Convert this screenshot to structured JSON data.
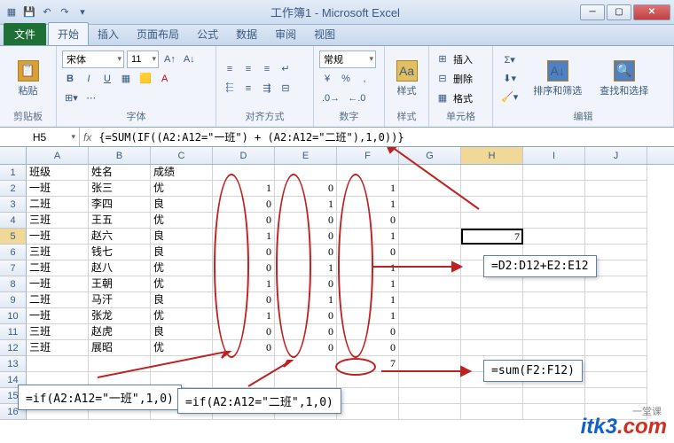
{
  "title": "工作簿1 - Microsoft Excel",
  "tabs": {
    "file": "文件",
    "home": "开始",
    "insert": "插入",
    "layout": "页面布局",
    "formula": "公式",
    "data": "数据",
    "review": "审阅",
    "view": "视图"
  },
  "ribbon": {
    "clipboard": {
      "label": "剪贴板",
      "paste": "粘贴"
    },
    "font": {
      "label": "字体",
      "name": "宋体",
      "size": "11"
    },
    "align": {
      "label": "对齐方式"
    },
    "number": {
      "label": "数字",
      "format": "常规"
    },
    "styles": {
      "label": "样式",
      "btn": "样式"
    },
    "cells": {
      "label": "单元格",
      "insert": "插入",
      "delete": "删除",
      "format": "格式"
    },
    "editing": {
      "label": "编辑",
      "sort": "排序和筛选",
      "find": "查找和选择"
    }
  },
  "namebox": "H5",
  "formula": "{=SUM(IF((A2:A12=\"一班\") + (A2:A12=\"二班\"),1,0))}",
  "cols": [
    "A",
    "B",
    "C",
    "D",
    "E",
    "F",
    "G",
    "H",
    "I",
    "J"
  ],
  "rows": [
    {
      "n": "1",
      "c": [
        "班级",
        "姓名",
        "成绩",
        "",
        "",
        "",
        "",
        "",
        "",
        ""
      ]
    },
    {
      "n": "2",
      "c": [
        "一班",
        "张三",
        "优",
        "1",
        "0",
        "1",
        "",
        "",
        "",
        ""
      ]
    },
    {
      "n": "3",
      "c": [
        "二班",
        "李四",
        "良",
        "0",
        "1",
        "1",
        "",
        "",
        "",
        ""
      ]
    },
    {
      "n": "4",
      "c": [
        "三班",
        "王五",
        "优",
        "0",
        "0",
        "0",
        "",
        "",
        "",
        ""
      ]
    },
    {
      "n": "5",
      "c": [
        "一班",
        "赵六",
        "良",
        "1",
        "0",
        "1",
        "",
        "7",
        "",
        ""
      ]
    },
    {
      "n": "6",
      "c": [
        "三班",
        "钱七",
        "良",
        "0",
        "0",
        "0",
        "",
        "",
        "",
        ""
      ]
    },
    {
      "n": "7",
      "c": [
        "二班",
        "赵八",
        "优",
        "0",
        "1",
        "1",
        "",
        "",
        "",
        ""
      ]
    },
    {
      "n": "8",
      "c": [
        "一班",
        "王朝",
        "优",
        "1",
        "0",
        "1",
        "",
        "",
        "",
        ""
      ]
    },
    {
      "n": "9",
      "c": [
        "二班",
        "马汗",
        "良",
        "0",
        "1",
        "1",
        "",
        "",
        "",
        ""
      ]
    },
    {
      "n": "10",
      "c": [
        "一班",
        "张龙",
        "优",
        "1",
        "0",
        "1",
        "",
        "",
        "",
        ""
      ]
    },
    {
      "n": "11",
      "c": [
        "三班",
        "赵虎",
        "良",
        "0",
        "0",
        "0",
        "",
        "",
        "",
        ""
      ]
    },
    {
      "n": "12",
      "c": [
        "三班",
        "展昭",
        "优",
        "0",
        "0",
        "0",
        "",
        "",
        "",
        ""
      ]
    },
    {
      "n": "13",
      "c": [
        "",
        "",
        "",
        "",
        "",
        "7",
        "",
        "",
        "",
        ""
      ]
    },
    {
      "n": "14",
      "c": [
        "",
        "",
        "",
        "",
        "",
        "",
        "",
        "",
        "",
        ""
      ]
    },
    {
      "n": "15",
      "c": [
        "",
        "",
        "",
        "",
        "",
        "",
        "",
        "",
        "",
        ""
      ]
    },
    {
      "n": "16",
      "c": [
        "",
        "",
        "",
        "",
        "",
        "",
        "",
        "",
        "",
        ""
      ]
    }
  ],
  "callouts": {
    "c1": "=if(A2:A12=\"一班\",1,0)",
    "c2": "=if(A2:A12=\"二班\",1,0)",
    "c3": "=D2:D12+E2:E12",
    "c4": "=sum(F2:F12)"
  },
  "watermark": {
    "blue": "itk3",
    "red": ".com",
    "sub": "一堂课"
  }
}
